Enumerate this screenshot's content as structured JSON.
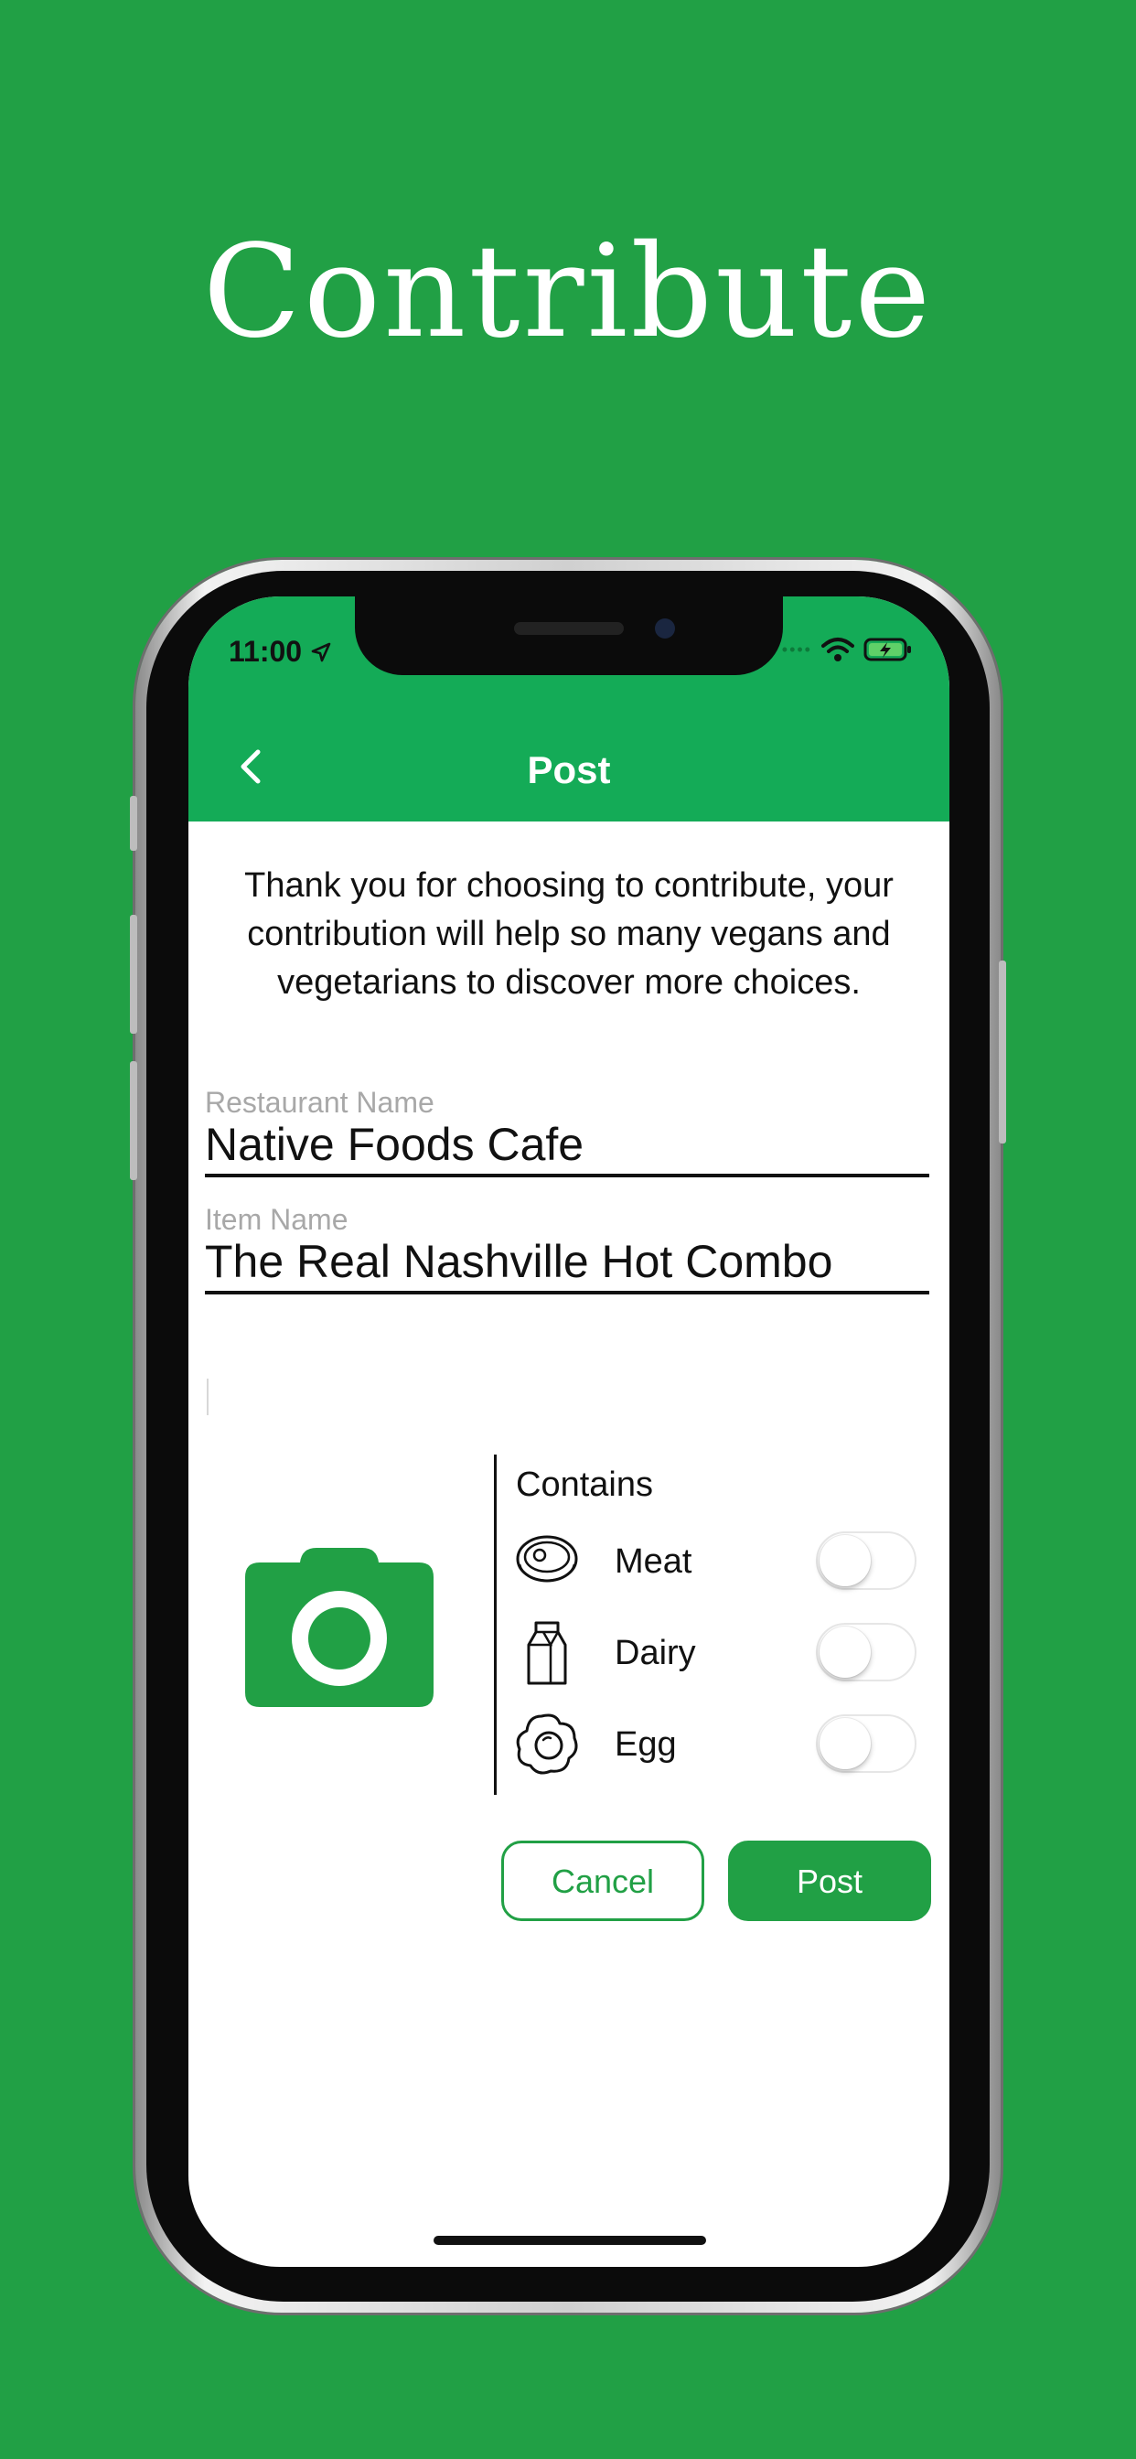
{
  "headline": "Contribute",
  "status": {
    "time": "11:00"
  },
  "nav": {
    "title": "Post"
  },
  "intro_text": "Thank you for choosing to contribute, your contribution will help so many vegans and vegetarians to discover more choices.",
  "fields": {
    "restaurant": {
      "label": "Restaurant Name",
      "value": "Native Foods Cafe"
    },
    "item": {
      "label": "Item Name",
      "value": "The Real Nashville Hot Combo"
    }
  },
  "contains": {
    "title": "Contains",
    "items": [
      {
        "label": "Meat",
        "icon": "meat-icon",
        "on": false
      },
      {
        "label": "Dairy",
        "icon": "milk-carton-icon",
        "on": false
      },
      {
        "label": "Egg",
        "icon": "egg-icon",
        "on": false
      }
    ]
  },
  "buttons": {
    "cancel": "Cancel",
    "post": "Post"
  },
  "colors": {
    "brand_green": "#21a045",
    "nav_green": "#14ab57"
  }
}
